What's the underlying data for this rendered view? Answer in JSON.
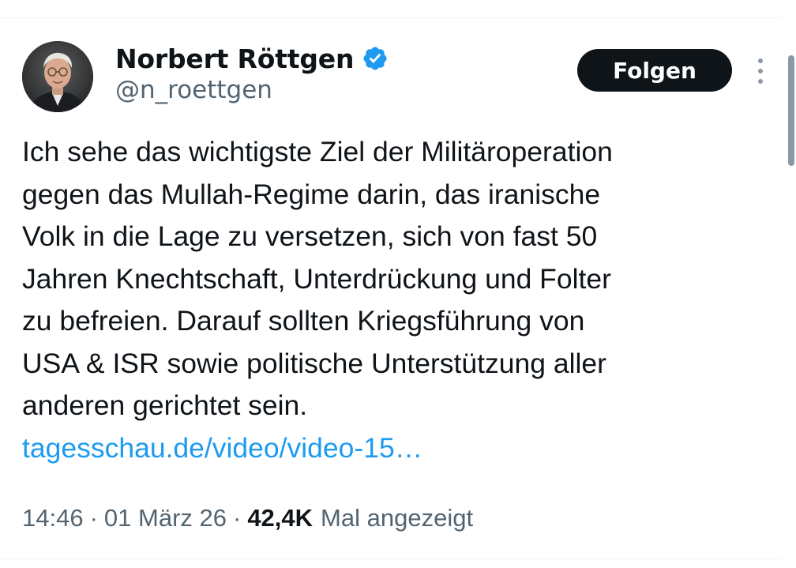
{
  "author": {
    "display_name": "Norbert Röttgen",
    "handle": "@n_roettgen",
    "verified_icon": "verified-badge-icon",
    "avatar_icon": "profile-photo"
  },
  "actions": {
    "follow_label": "Folgen",
    "more_icon": "more-vertical-icon"
  },
  "tweet": {
    "lines": [
      "Ich sehe das wichtigste Ziel der Militäroperation",
      "gegen das Mullah-Regime darin, das iranische",
      "Volk in die Lage zu versetzen, sich von fast 50",
      "Jahren Knechtschaft, Unterdrückung und Folter",
      "zu befreien. Darauf sollten Kriegsführung von",
      "USA & ISR sowie politische Unterstützung aller",
      "anderen gerichtet sein."
    ],
    "link_text": "tagesschau.de/video/video-15…"
  },
  "meta": {
    "time": "14:46",
    "separator": "·",
    "date": "01 März 26",
    "views_count": "42,4K",
    "views_label": "Mal angezeigt"
  },
  "colors": {
    "accent_link": "#1d9bf0",
    "text_primary": "#0f1419",
    "text_secondary": "#536471",
    "verified_blue": "#1d9bf0",
    "button_bg": "#0f1419"
  }
}
